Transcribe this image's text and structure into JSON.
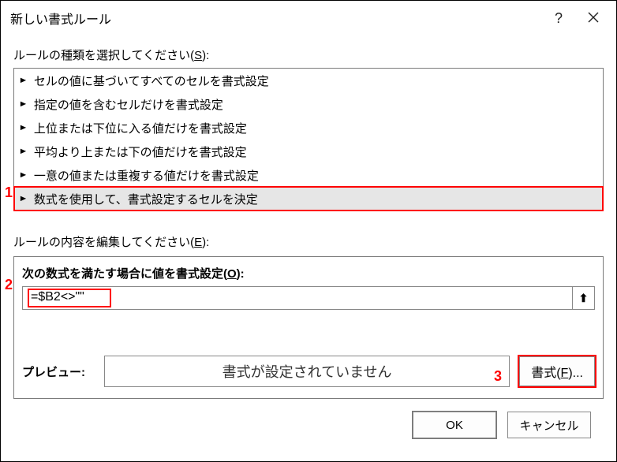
{
  "title": "新しい書式ルール",
  "help_icon": "?",
  "section_select_label_pre": "ルールの種類を選択してください(",
  "section_select_accel": "S",
  "section_select_label_post": "):",
  "rules": [
    "セルの値に基づいてすべてのセルを書式設定",
    "指定の値を含むセルだけを書式設定",
    "上位または下位に入る値だけを書式設定",
    "平均より上または下の値だけを書式設定",
    "一意の値または重複する値だけを書式設定",
    "数式を使用して、書式設定するセルを決定"
  ],
  "edit_label_pre": "ルールの内容を編集してください(",
  "edit_accel": "E",
  "edit_label_post": "):",
  "formula_label_pre": "次の数式を満たす場合に値を書式設定(",
  "formula_accel": "O",
  "formula_label_post": "):",
  "formula_value": "=$B2<>\"\"",
  "refpicker_icon": "⬆",
  "preview_label": "プレビュー:",
  "preview_text": "書式が設定されていません",
  "format_btn_pre": "書式(",
  "format_btn_accel": "F",
  "format_btn_post": ")...",
  "ok_label": "OK",
  "cancel_label": "キャンセル",
  "markers": {
    "m1": "1",
    "m2": "2",
    "m3": "3"
  }
}
